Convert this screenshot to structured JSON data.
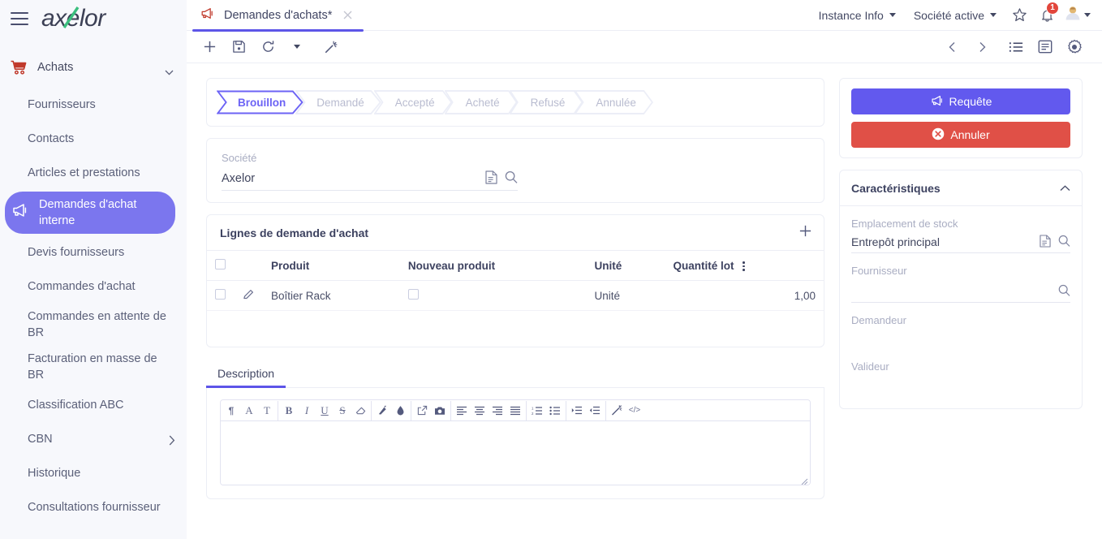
{
  "brand": {
    "name": "axelor",
    "menu_icon": "hamburger-icon"
  },
  "sidebar": {
    "group": {
      "label": "Achats",
      "icon": "shopping-cart-icon",
      "chevron": "chevron-down-icon"
    },
    "items": [
      {
        "label": "Fournisseurs",
        "active": false,
        "icon": null,
        "chevron": null
      },
      {
        "label": "Contacts",
        "active": false,
        "icon": null,
        "chevron": null
      },
      {
        "label": "Articles et prestations",
        "active": false,
        "icon": null,
        "chevron": null
      },
      {
        "label": "Demandes d'achat interne",
        "active": true,
        "icon": "megaphone-icon",
        "chevron": null
      },
      {
        "label": "Devis fournisseurs",
        "active": false,
        "icon": null,
        "chevron": null
      },
      {
        "label": "Commandes d'achat",
        "active": false,
        "icon": null,
        "chevron": null
      },
      {
        "label": "Commandes en attente de BR",
        "active": false,
        "icon": null,
        "chevron": null
      },
      {
        "label": "Facturation en masse de BR",
        "active": false,
        "icon": null,
        "chevron": null
      },
      {
        "label": "Classification ABC",
        "active": false,
        "icon": null,
        "chevron": null
      },
      {
        "label": "CBN",
        "active": false,
        "icon": null,
        "chevron": "chevron-right-icon"
      },
      {
        "label": "Historique",
        "active": false,
        "icon": null,
        "chevron": null
      },
      {
        "label": "Consultations fournisseur",
        "active": false,
        "icon": null,
        "chevron": null
      }
    ]
  },
  "topbar": {
    "tab": {
      "label": "Demandes d'achats*",
      "icon": "megaphone-icon",
      "close_icon": "close-icon"
    },
    "instance_info": "Instance Info",
    "active_company": "Société active",
    "favorite_icon": "star-icon",
    "notification_icon": "bell-icon",
    "notification_count": "1",
    "avatar_icon": "user-avatar-icon"
  },
  "toolbar": {
    "new_icon": "plus-icon",
    "save_icon": "save-icon",
    "refresh_icon": "refresh-icon",
    "more_icon": "caret-down-icon",
    "tools_icon": "magic-wand-icon",
    "prev_icon": "chevron-left-icon",
    "next_icon": "chevron-right-icon",
    "list_icon": "list-view-icon",
    "form_icon": "form-view-icon",
    "settings_icon": "gear-icon"
  },
  "workflow": {
    "steps": [
      {
        "label": "Brouillon",
        "current": true
      },
      {
        "label": "Demandé",
        "current": false
      },
      {
        "label": "Accepté",
        "current": false
      },
      {
        "label": "Acheté",
        "current": false
      },
      {
        "label": "Refusé",
        "current": false
      },
      {
        "label": "Annulée",
        "current": false
      }
    ]
  },
  "company_section": {
    "label": "Société",
    "value": "Axelor",
    "placeholder": "",
    "view_icon": "document-icon",
    "search_icon": "search-icon"
  },
  "lines": {
    "title": "Lignes de demande d'achat",
    "add_icon": "plus-icon",
    "edit_icon": "pencil-icon",
    "kebab_icon": "column-options-icon",
    "columns": [
      "Produit",
      "Nouveau produit",
      "Unité",
      "Quantité lot"
    ],
    "rows": [
      {
        "produit": "Boîtier Rack",
        "nouveau_produit": false,
        "unite": "Unité",
        "quantite_lot": "1,00"
      }
    ]
  },
  "description": {
    "tabs": [
      {
        "label": "Description",
        "active": true
      }
    ],
    "value": "",
    "editor_tools": [
      {
        "name": "paragraph-icon",
        "glyph": "¶"
      },
      {
        "name": "font-size-icon",
        "glyph": "A"
      },
      {
        "name": "text-style-icon",
        "glyph": "T"
      },
      {
        "name": "bold-icon",
        "glyph": "B"
      },
      {
        "name": "italic-icon",
        "glyph": "I"
      },
      {
        "name": "underline-icon",
        "glyph": "U"
      },
      {
        "name": "strikethrough-icon",
        "glyph": "S"
      },
      {
        "name": "eraser-icon",
        "glyph": ""
      },
      {
        "name": "text-color-icon",
        "glyph": ""
      },
      {
        "name": "background-color-icon",
        "glyph": ""
      },
      {
        "name": "link-icon",
        "glyph": ""
      },
      {
        "name": "image-icon",
        "glyph": ""
      },
      {
        "name": "align-left-icon",
        "glyph": ""
      },
      {
        "name": "align-center-icon",
        "glyph": ""
      },
      {
        "name": "align-right-icon",
        "glyph": ""
      },
      {
        "name": "align-justify-icon",
        "glyph": ""
      },
      {
        "name": "ordered-list-icon",
        "glyph": ""
      },
      {
        "name": "unordered-list-icon",
        "glyph": ""
      },
      {
        "name": "indent-icon",
        "glyph": ""
      },
      {
        "name": "outdent-icon",
        "glyph": ""
      },
      {
        "name": "clear-format-icon",
        "glyph": ""
      },
      {
        "name": "code-icon",
        "glyph": "</>"
      }
    ],
    "resize_handle": "resize-handle-icon"
  },
  "actions": {
    "request": {
      "label": "Requête",
      "icon": "megaphone-icon",
      "color": "#6259ee"
    },
    "cancel": {
      "label": "Annuler",
      "icon": "cancel-circle-icon",
      "color": "#e05047"
    }
  },
  "characteristics": {
    "title": "Caractéristiques",
    "collapse_icon": "chevron-up-icon",
    "fields": [
      {
        "label": "Emplacement de stock",
        "value": "Entrepôt principal",
        "view_icon": "document-icon",
        "search_icon": "search-icon"
      },
      {
        "label": "Fournisseur",
        "value": "",
        "view_icon": null,
        "search_icon": "search-icon"
      },
      {
        "label": "Demandeur",
        "value": "",
        "view_icon": null,
        "search_icon": null
      },
      {
        "label": "Valideur",
        "value": "",
        "view_icon": null,
        "search_icon": null
      }
    ]
  },
  "colors": {
    "accent": "#5d55e8",
    "sidebar_active": "#7b76ee",
    "danger": "#e05047",
    "sidebar_bg": "#f7f8fc",
    "brand_green": "#3bbf7e"
  }
}
